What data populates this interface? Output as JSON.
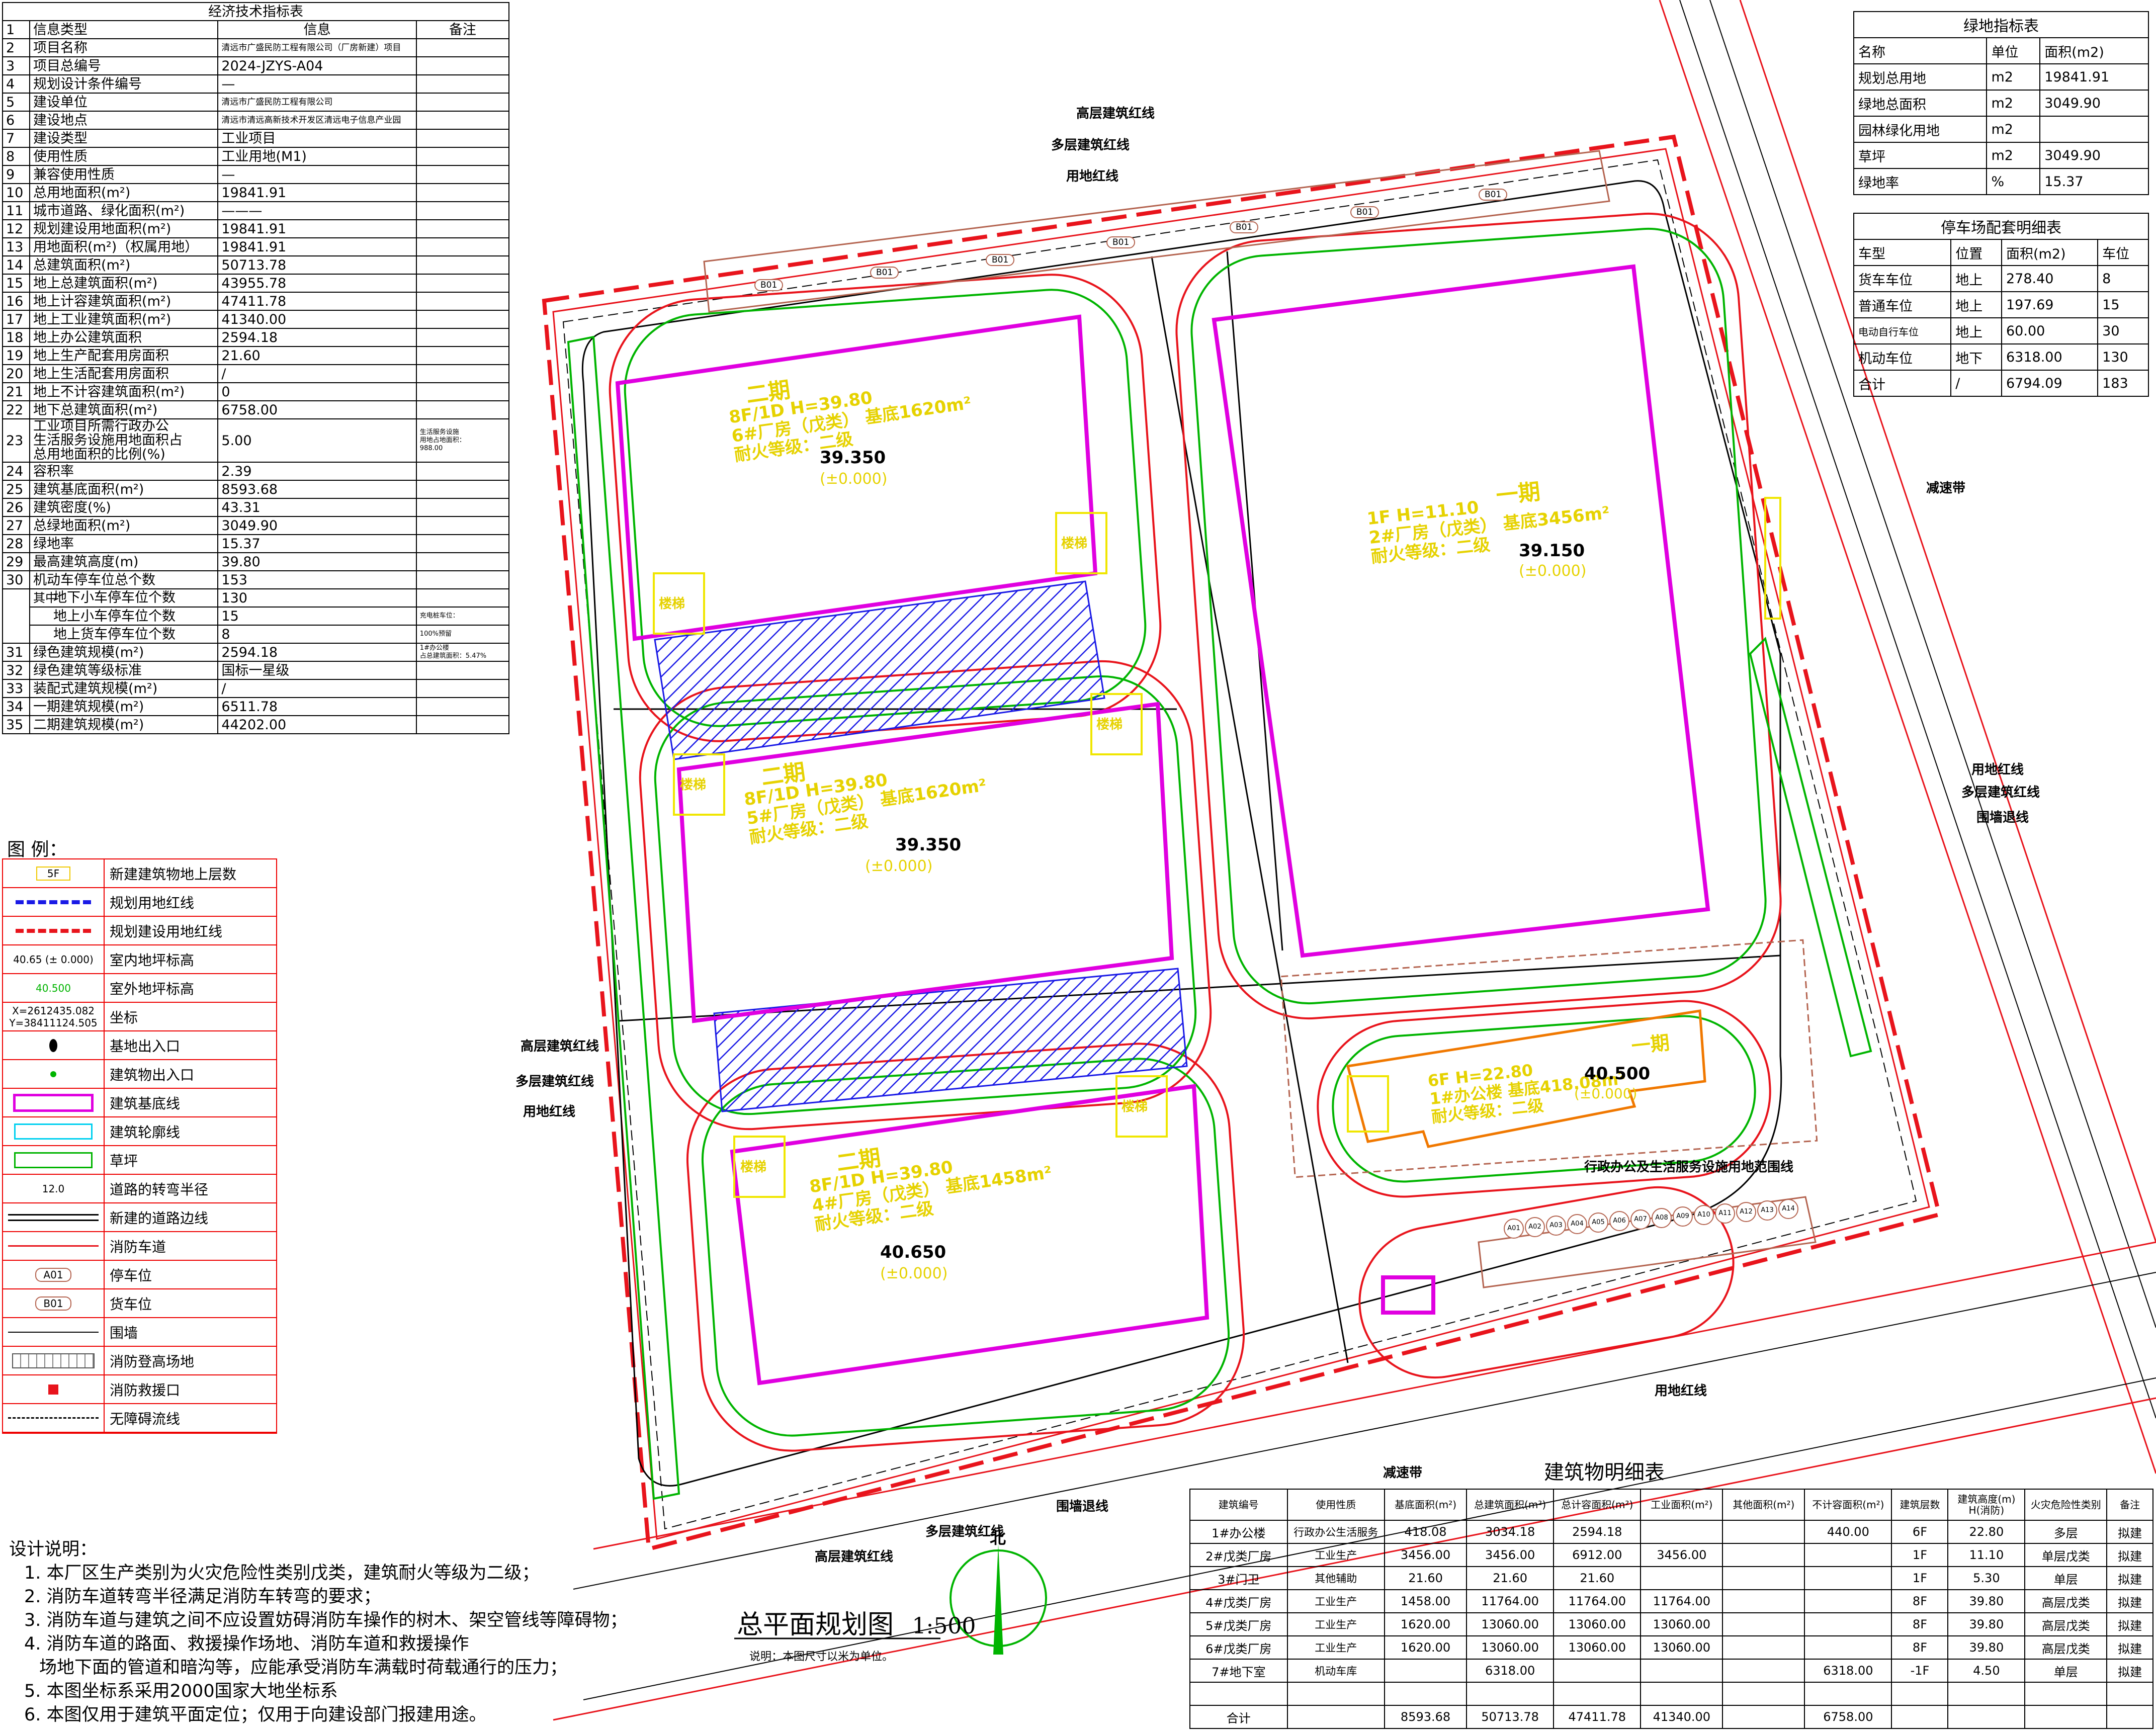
{
  "econ": {
    "title": "经济技术指标表",
    "head_info": "信息类型",
    "head_value": "信息",
    "head_note": "备注",
    "rows": [
      {
        "n": "1",
        "label": "信息类型",
        "value": "",
        "note": ""
      },
      {
        "n": "2",
        "label": "项目名称",
        "value": "清远市广盛民防工程有限公司（厂房新建）项目",
        "note": ""
      },
      {
        "n": "3",
        "label": "项目总编号",
        "value": "2024-JZYS-A04",
        "note": ""
      },
      {
        "n": "4",
        "label": "规划设计条件编号",
        "value": "—",
        "note": ""
      },
      {
        "n": "5",
        "label": "建设单位",
        "value": "清远市广盛民防工程有限公司",
        "note": ""
      },
      {
        "n": "6",
        "label": "建设地点",
        "value": "清远市清远高新技术开发区清远电子信息产业园",
        "note": ""
      },
      {
        "n": "7",
        "label": "建设类型",
        "value": "工业项目",
        "note": ""
      },
      {
        "n": "8",
        "label": "使用性质",
        "value": "工业用地(M1)",
        "note": ""
      },
      {
        "n": "9",
        "label": "兼容使用性质",
        "value": "—",
        "note": ""
      },
      {
        "n": "10",
        "label": "总用地面积(m²)",
        "value": "19841.91",
        "note": ""
      },
      {
        "n": "11",
        "label": "城市道路、绿化面积(m²)",
        "value": "———",
        "note": ""
      },
      {
        "n": "12",
        "label": "规划建设用地面积(m²)",
        "value": "19841.91",
        "note": ""
      },
      {
        "n": "13",
        "label": "用地面积(m²)（权属用地）",
        "value": "19841.91",
        "note": ""
      },
      {
        "n": "14",
        "label": "总建筑面积(m²)",
        "value": "50713.78",
        "note": ""
      },
      {
        "n": "15",
        "label": "地上总建筑面积(m²)",
        "value": "43955.78",
        "note": ""
      },
      {
        "n": "16",
        "label": "地上计容建筑面积(m²)",
        "value": "47411.78",
        "note": ""
      },
      {
        "n": "17",
        "label": "地上工业建筑面积(m²)",
        "value": "41340.00",
        "note": ""
      },
      {
        "n": "18",
        "label": "地上办公建筑面积",
        "value": "2594.18",
        "note": ""
      },
      {
        "n": "19",
        "label": "地上生产配套用房面积",
        "value": "21.60",
        "note": ""
      },
      {
        "n": "20",
        "label": "地上生活配套用房面积",
        "value": "/",
        "note": ""
      },
      {
        "n": "21",
        "label": "地上不计容建筑面积(m²)",
        "value": "0",
        "note": ""
      },
      {
        "n": "22",
        "label": "地下总建筑面积(m²)",
        "value": "6758.00",
        "note": ""
      },
      {
        "n": "24",
        "label": "容积率",
        "value": "2.39",
        "note": ""
      },
      {
        "n": "25",
        "label": "建筑基底面积(m²)",
        "value": "8593.68",
        "note": ""
      },
      {
        "n": "26",
        "label": "建筑密度(%)",
        "value": "43.31",
        "note": ""
      },
      {
        "n": "27",
        "label": "总绿地面积(m²)",
        "value": "3049.90",
        "note": ""
      },
      {
        "n": "28",
        "label": "绿地率",
        "value": "15.37",
        "note": ""
      },
      {
        "n": "29",
        "label": "最高建筑高度(m)",
        "value": "39.80",
        "note": ""
      },
      {
        "n": "30",
        "label": "机动车停车位总个数",
        "value": "153",
        "note": ""
      }
    ],
    "row23": {
      "n": "23",
      "label1": "工业项目所需行政办公",
      "label2": "生活服务设施用地面积占",
      "label3": "总用地面积的比例(%)",
      "value": "5.00",
      "note1": "生活服务设施",
      "note2": "用地占地面积：",
      "note3": "988.00"
    },
    "sub_group": "其中",
    "sub_rows": [
      {
        "label": "地下小车停车位个数",
        "value": "130",
        "note": ""
      },
      {
        "label": "地上小车停车位个数",
        "value": "15",
        "note": "充电桩车位："
      },
      {
        "label": "地上货车停车位个数",
        "value": "8",
        "note": "100%预留"
      }
    ],
    "tail_rows": [
      {
        "n": "31",
        "label": "绿色建筑规模(m²)",
        "value": "2594.18",
        "note1": "1#办公楼",
        "note2": "占总建筑面积：5.47%"
      },
      {
        "n": "32",
        "label": "绿色建筑等级标准",
        "value": "国标一星级",
        "note1": "",
        "note2": ""
      },
      {
        "n": "33",
        "label": "装配式建筑规模(m²)",
        "value": "/",
        "note1": "",
        "note2": ""
      },
      {
        "n": "34",
        "label": "一期建筑规模(m²)",
        "value": "6511.78",
        "note1": "",
        "note2": ""
      },
      {
        "n": "35",
        "label": "二期建筑规模(m²)",
        "value": "44202.00",
        "note1": "",
        "note2": ""
      }
    ]
  },
  "green": {
    "title": "绿地指标表",
    "headers": [
      "名称",
      "单位",
      "面积(m2)"
    ],
    "rows": [
      [
        "规划总用地",
        "m2",
        "19841.91"
      ],
      [
        "绿地总面积",
        "m2",
        "3049.90"
      ],
      [
        "园林绿化用地",
        "m2",
        ""
      ],
      [
        "草坪",
        "m2",
        "3049.90"
      ],
      [
        "绿地率",
        "%",
        "15.37"
      ]
    ]
  },
  "parking": {
    "title": "停车场配套明细表",
    "headers": [
      "车型",
      "位置",
      "面积(m2)",
      "车位"
    ],
    "rows": [
      [
        "货车车位",
        "地上",
        "278.40",
        "8"
      ],
      [
        "普通车位",
        "地上",
        "197.69",
        "15"
      ],
      [
        "电动自行车位",
        "地上",
        "60.00",
        "30"
      ],
      [
        "机动车位",
        "地下",
        "6318.00",
        "130"
      ],
      [
        "合计",
        "/",
        "6794.09",
        "183"
      ]
    ]
  },
  "buildings": {
    "title": "建筑物明细表",
    "headers": [
      "建筑编号",
      "使用性质",
      "基底面积(m²)",
      "总建筑面积(m²)",
      "总计容面积(m²)",
      "工业面积(m²)",
      "其他面积(m²)",
      "不计容面积(m²)",
      "建筑层数",
      "建筑高度(m) H(消防)",
      "火灾危险性类别",
      "备注"
    ],
    "rows": [
      [
        "1#办公楼",
        "行政办公生活服务",
        "418.08",
        "3034.18",
        "2594.18",
        "",
        "",
        "440.00",
        "6F",
        "22.80",
        "多层",
        "拟建"
      ],
      [
        "2#戊类厂房",
        "工业生产",
        "3456.00",
        "3456.00",
        "6912.00",
        "3456.00",
        "",
        "",
        "1F",
        "11.10",
        "单层戊类",
        "拟建"
      ],
      [
        "3#门卫",
        "其他辅助",
        "21.60",
        "21.60",
        "21.60",
        "",
        "",
        "",
        "1F",
        "5.30",
        "单层",
        "拟建"
      ],
      [
        "4#戊类厂房",
        "工业生产",
        "1458.00",
        "11764.00",
        "11764.00",
        "11764.00",
        "",
        "",
        "8F",
        "39.80",
        "高层戊类",
        "拟建"
      ],
      [
        "5#戊类厂房",
        "工业生产",
        "1620.00",
        "13060.00",
        "13060.00",
        "13060.00",
        "",
        "",
        "8F",
        "39.80",
        "高层戊类",
        "拟建"
      ],
      [
        "6#戊类厂房",
        "工业生产",
        "1620.00",
        "13060.00",
        "13060.00",
        "13060.00",
        "",
        "",
        "8F",
        "39.80",
        "高层戊类",
        "拟建"
      ],
      [
        "7#地下室",
        "机动车库",
        "",
        "6318.00",
        "",
        "",
        "",
        "6318.00",
        "-1F",
        "4.50",
        "单层",
        "拟建"
      ],
      [
        "",
        "",
        "",
        "",
        "",
        "",
        "",
        "",
        "",
        "",
        "",
        ""
      ],
      [
        "合计",
        "",
        "8593.68",
        "50713.78",
        "47411.78",
        "41340.00",
        "",
        "6758.00",
        "",
        "",
        "",
        ""
      ]
    ]
  },
  "legend": {
    "title": "图    例：",
    "items": [
      {
        "sym": "5F",
        "label": "新建建筑物地上层数"
      },
      {
        "sym": "",
        "label": "规划用地红线"
      },
      {
        "sym": "",
        "label": "规划建设用地红线"
      },
      {
        "sym": "40.65 (± 0.000)",
        "label": "室内地坪标高"
      },
      {
        "sym": "40.500",
        "label": "室外地坪标高"
      },
      {
        "sym": "X=2612435.082 Y=38411124.505",
        "label": "坐标"
      },
      {
        "sym": "",
        "label": "基地出入口"
      },
      {
        "sym": "",
        "label": "建筑物出入口"
      },
      {
        "sym": "",
        "label": "建筑基底线"
      },
      {
        "sym": "",
        "label": "建筑轮廓线"
      },
      {
        "sym": "",
        "label": "草坪"
      },
      {
        "sym": "12.0",
        "label": "道路的转弯半径"
      },
      {
        "sym": "",
        "label": "新建的道路边线"
      },
      {
        "sym": "",
        "label": "消防车道"
      },
      {
        "sym": "A01",
        "label": "停车位"
      },
      {
        "sym": "B01",
        "label": "货车位"
      },
      {
        "sym": "",
        "label": "围墙"
      },
      {
        "sym": "",
        "label": "消防登高场地"
      },
      {
        "sym": "",
        "label": "消防救援口"
      },
      {
        "sym": "",
        "label": "无障碍流线"
      }
    ]
  },
  "notes": {
    "title": "设计说明：",
    "lines": [
      "1. 本厂区生产类别为火灾危险性类别戊类，建筑耐火等级为二级；",
      "2. 消防车道转弯半径满足消防车转弯的要求；",
      "3. 消防车道与建筑之间不应设置妨碍消防车操作的树木、架空管线等障碍物；",
      "4. 消防车道的路面、救援操作场地、消防车道和救援操作",
      "场地下面的管道和暗沟等，应能承受消防车满载时荷载通行的压力；",
      "5. 本图坐标系采用2000国家大地坐标系",
      "6. 本图仅用于建筑平面定位；仅用于向建设部门报建用途。"
    ]
  },
  "plan": {
    "title": "总平面规划图",
    "scale": "1:500",
    "note": "说明：本图尺寸以米为单位。",
    "north": "北",
    "labels": {
      "high_line": "高层建筑红线",
      "multi_line": "多层建筑红线",
      "land_line": "用地红线",
      "wall_line": "围墙退线",
      "speed_bump": "减速带",
      "admin_area": "行政办公及生活服务设施用地范围线"
    },
    "b_phase2_a": {
      "phase": "二期",
      "l1": "8F/1D   H=39.80",
      "l2": "6#厂房（戊类）  基底1620m²",
      "l3": "耐火等级：二级",
      "elev": "39.350",
      "zero": "(±0.000)"
    },
    "b_phase2_b": {
      "phase": "二期",
      "l1": "8F/1D   H=39.80",
      "l2": "5#厂房（戊类）  基底1620m²",
      "l3": "耐火等级：二级",
      "elev": "39.350",
      "zero": "(±0.000)"
    },
    "b_phase2_c": {
      "phase": "二期",
      "l1": "8F/1D   H=39.80",
      "l2": "4#厂房（戊类）  基底1458m²",
      "l3": "耐火等级：二级",
      "elev": "40.650",
      "zero": "(±0.000)"
    },
    "b_phase1": {
      "phase": "一期",
      "l1": "1F      H=11.10",
      "l2": "2#厂房（戊类）  基底3456m²",
      "l3": "耐火等级：二级",
      "elev": "39.150",
      "zero": "(±0.000)"
    },
    "b_office": {
      "phase": "一期",
      "l1": "6F   H=22.80",
      "l2": "1#办公楼  基底418.08m²",
      "l3": "耐火等级：二级",
      "elev": "40.500",
      "zero": "(±0.000)"
    },
    "stair": "楼梯",
    "truck_spots": [
      "B01",
      "B01",
      "B01",
      "B01",
      "B01",
      "B01",
      "B01"
    ],
    "car_spots": [
      "A01",
      "A02",
      "A03",
      "A04",
      "A05",
      "A06",
      "A07",
      "A08",
      "A09",
      "A10",
      "A11",
      "A12",
      "A13",
      "A14"
    ]
  },
  "colors": {
    "red": "#e8141c",
    "green": "#00b400",
    "magenta": "#e000e0",
    "yellow": "#f0e600",
    "blue": "#1a1ae6",
    "orange": "#f07800"
  }
}
